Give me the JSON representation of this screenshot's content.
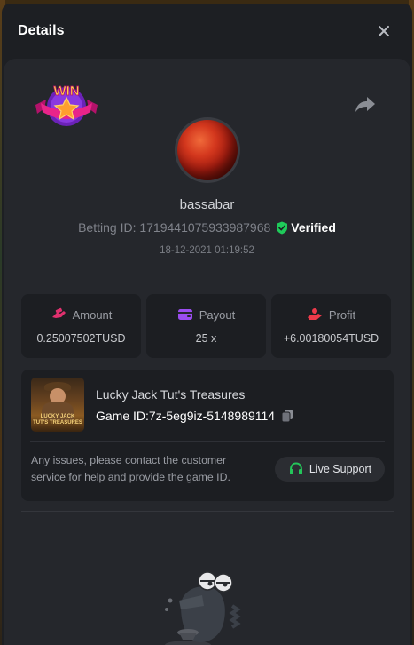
{
  "modal": {
    "title": "Details"
  },
  "user": {
    "username": "bassabar",
    "betting_id": "Betting ID: 1719441075933987968",
    "verified_label": "Verified",
    "timestamp": "18-12-2021 01:19:52"
  },
  "badge": {
    "text": "WIN"
  },
  "stats": [
    {
      "label": "Amount",
      "value": "0.25007502TUSD",
      "icon": "money-hand-icon",
      "icon_color": "#e0306e"
    },
    {
      "label": "Payout",
      "value": "25 x",
      "icon": "wallet-icon",
      "icon_color": "#9b4df0"
    },
    {
      "label": "Profit",
      "value": "+6.00180054TUSD",
      "icon": "profit-hand-icon",
      "icon_color": "#ee3a4a"
    }
  ],
  "game": {
    "name": "Lucky Jack Tut's Treasures",
    "id_text": "Game ID:7z-5eg9iz-5148989114",
    "thumb_text": "LUCKY JACK TUT'S TREASURES",
    "note": "Any issues, please contact the customer service for help and provide the game ID.",
    "support_label": "Live Support"
  },
  "colors": {
    "verified_green": "#1fca5a",
    "support_green": "#24c55a",
    "panel_bg": "#25272c",
    "card_bg": "#1c1e22"
  }
}
